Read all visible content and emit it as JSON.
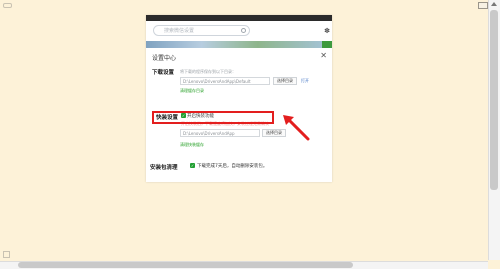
{
  "search": {
    "placeholder": "搜索微信设置"
  },
  "dialog": {
    "title": "设置中心",
    "close_icon": "close-icon",
    "download": {
      "label": "下载设置",
      "hint": "将下载的程序保存到以下目录：",
      "path": "D:\\Lenovo\\DriversAndApp\\Default",
      "choose": "选择目录",
      "open": "打开",
      "clear": "清理缓存目录"
    },
    "quick": {
      "label": "快装设置",
      "checkbox_label": "开启快装功能",
      "warning": "开启快装后，下载速度将加快，安装过程无需确认",
      "path": "D:\\Lenovo\\DriversAndApp",
      "choose": "选择目录",
      "clear": "清理快装缓存"
    },
    "cleanup": {
      "label": "安装包清理",
      "checkbox_label": "下载完成7天后，自动删除安装包。"
    }
  },
  "colors": {
    "page_bg": "#fdf2d8",
    "highlight": "#e31e1e",
    "check_green": "#22a033"
  }
}
